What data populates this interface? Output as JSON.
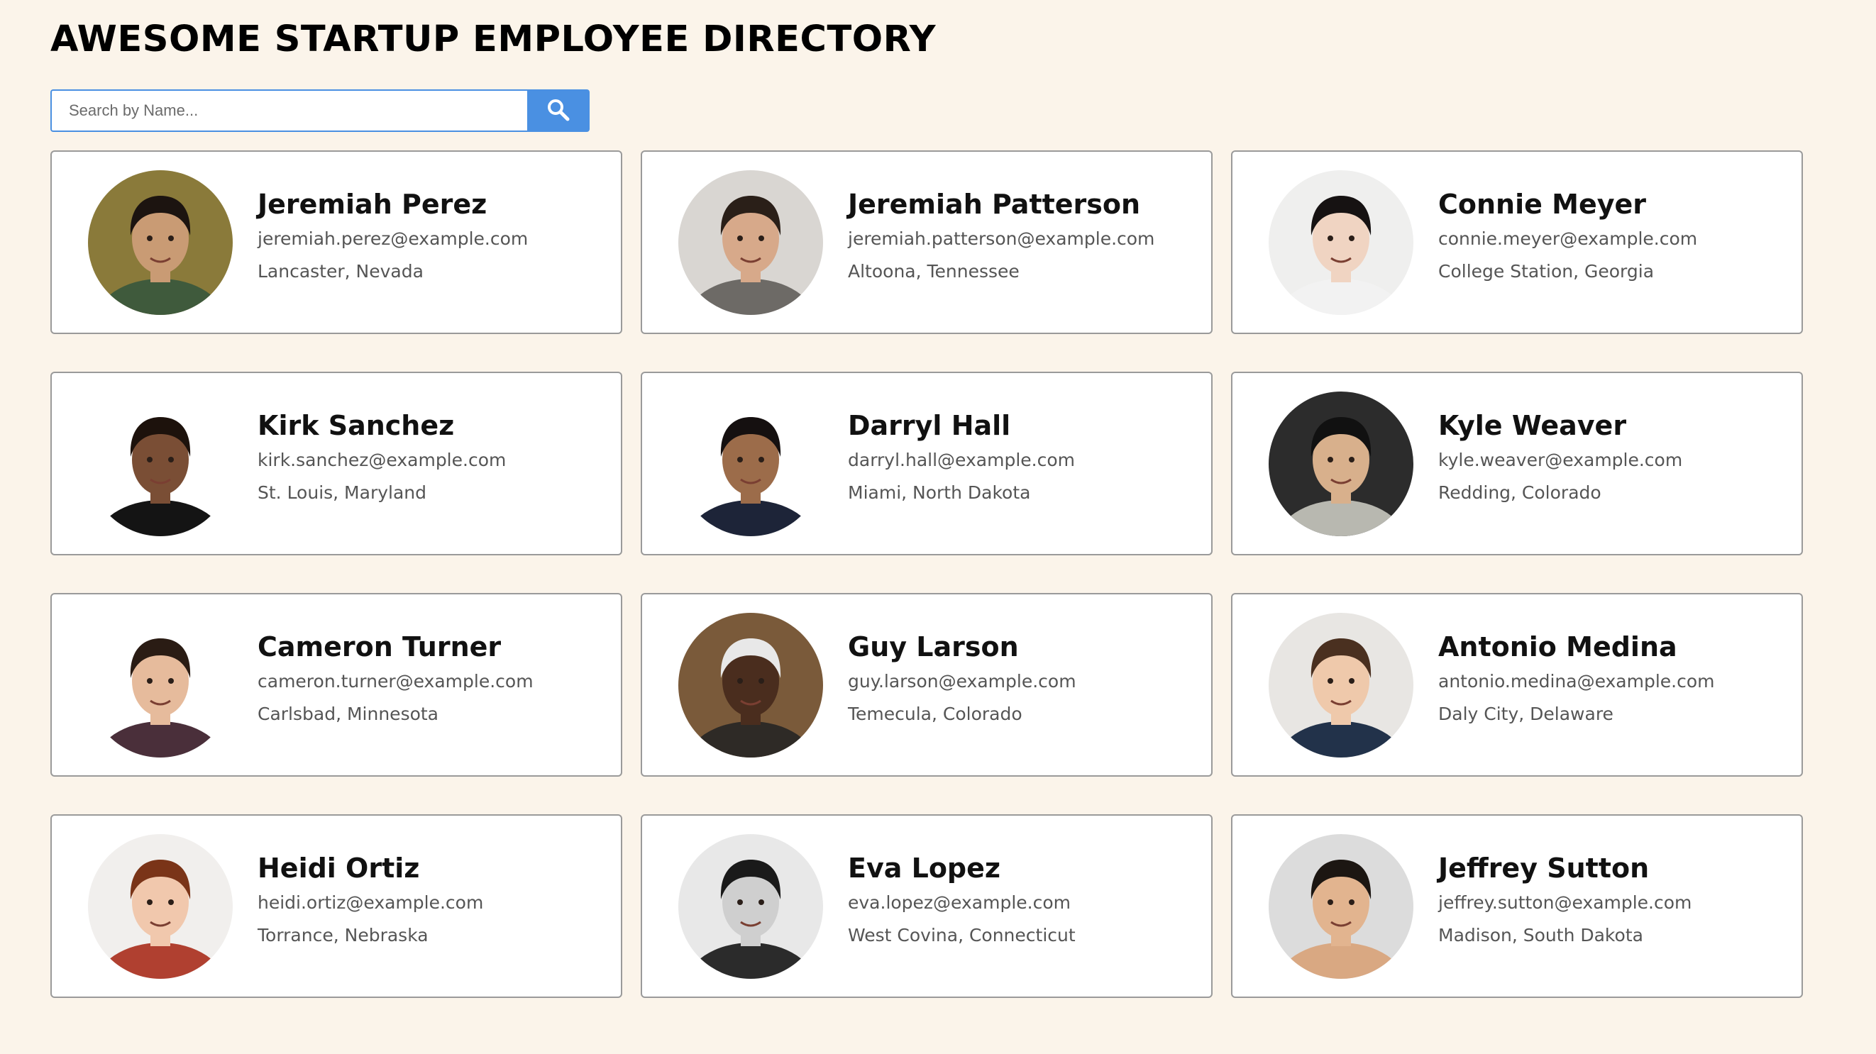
{
  "header": {
    "title": "AWESOME STARTUP EMPLOYEE DIRECTORY"
  },
  "search": {
    "placeholder": "Search by Name...",
    "button_icon": "search-icon"
  },
  "colors": {
    "background": "#fbf4ea",
    "accent": "#4a90e2",
    "card_border": "#9a9a9a"
  },
  "employees": [
    {
      "name": "Jeremiah Perez",
      "email": "jeremiah.perez@example.com",
      "location": "Lancaster, Nevada"
    },
    {
      "name": "Jeremiah Patterson",
      "email": "jeremiah.patterson@example.com",
      "location": "Altoona, Tennessee"
    },
    {
      "name": "Connie Meyer",
      "email": "connie.meyer@example.com",
      "location": "College Station, Georgia"
    },
    {
      "name": "Kirk Sanchez",
      "email": "kirk.sanchez@example.com",
      "location": "St. Louis, Maryland"
    },
    {
      "name": "Darryl Hall",
      "email": "darryl.hall@example.com",
      "location": "Miami, North Dakota"
    },
    {
      "name": "Kyle Weaver",
      "email": "kyle.weaver@example.com",
      "location": "Redding, Colorado"
    },
    {
      "name": "Cameron Turner",
      "email": "cameron.turner@example.com",
      "location": "Carlsbad, Minnesota"
    },
    {
      "name": "Guy Larson",
      "email": "guy.larson@example.com",
      "location": "Temecula, Colorado"
    },
    {
      "name": "Antonio Medina",
      "email": "antonio.medina@example.com",
      "location": "Daly City, Delaware"
    },
    {
      "name": "Heidi Ortiz",
      "email": "heidi.ortiz@example.com",
      "location": "Torrance, Nebraska"
    },
    {
      "name": "Eva Lopez",
      "email": "eva.lopez@example.com",
      "location": "West Covina, Connecticut"
    },
    {
      "name": "Jeffrey Sutton",
      "email": "jeffrey.sutton@example.com",
      "location": "Madison, South Dakota"
    }
  ]
}
